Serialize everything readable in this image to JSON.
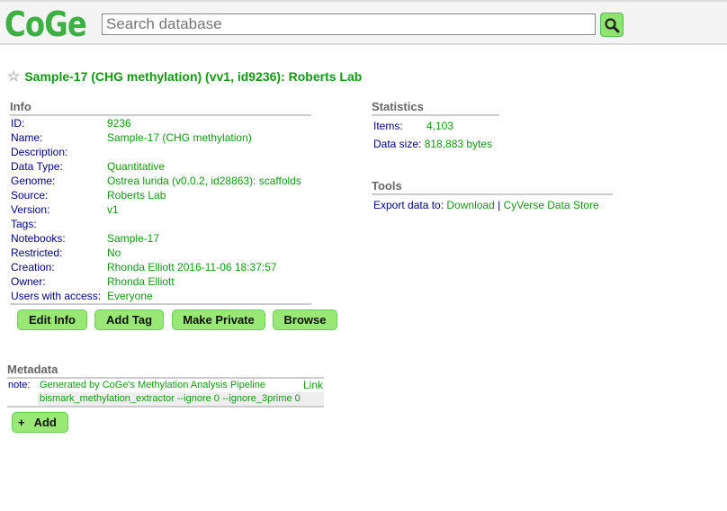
{
  "header": {
    "logo": "CoGe",
    "search_placeholder": "Search database"
  },
  "title": "Sample-17 (CHG methylation) (vv1, id9236): Roberts Lab",
  "info": {
    "heading": "Info",
    "rows": [
      {
        "label": "ID:",
        "value": "9236"
      },
      {
        "label": "Name:",
        "value": "Sample-17 (CHG methylation)"
      },
      {
        "label": "Description:",
        "value": ""
      },
      {
        "label": "Data Type:",
        "value": "Quantitative"
      },
      {
        "label": "Genome:",
        "value": "Ostrea lurida (v0.0.2, id28863): scaffolds"
      },
      {
        "label": "Source:",
        "value": "Roberts Lab"
      },
      {
        "label": "Version:",
        "value": "v1"
      },
      {
        "label": "Tags:",
        "value": ""
      },
      {
        "label": "Notebooks:",
        "value": "Sample-17"
      },
      {
        "label": "Restricted:",
        "value": "No"
      },
      {
        "label": "Creation:",
        "value": "Rhonda Elliott 2016-11-06 18:37:57"
      },
      {
        "label": "Owner:",
        "value": "Rhonda Elliott"
      },
      {
        "label": "Users with access:",
        "value": "Everyone"
      }
    ]
  },
  "buttons": {
    "edit_info": "Edit Info",
    "add_tag": "Add Tag",
    "make_private": "Make Private",
    "browse": "Browse"
  },
  "statistics": {
    "heading": "Statistics",
    "items_label": "Items:",
    "items_value": "4,103",
    "size_label": "Data size:",
    "size_value": "818,883 bytes"
  },
  "tools": {
    "heading": "Tools",
    "export_label": "Export data to:",
    "download": "Download",
    "separator": "|",
    "cyverse": "CyVerse Data Store"
  },
  "metadata": {
    "heading": "Metadata",
    "key": "note:",
    "line1": "Generated by CoGe's Methylation Analysis Pipeline",
    "line2": "bismark_methylation_extractor --ignore 0 --ignore_3prime 0",
    "link": "Link",
    "add_label": "Add",
    "add_icon": "+"
  }
}
